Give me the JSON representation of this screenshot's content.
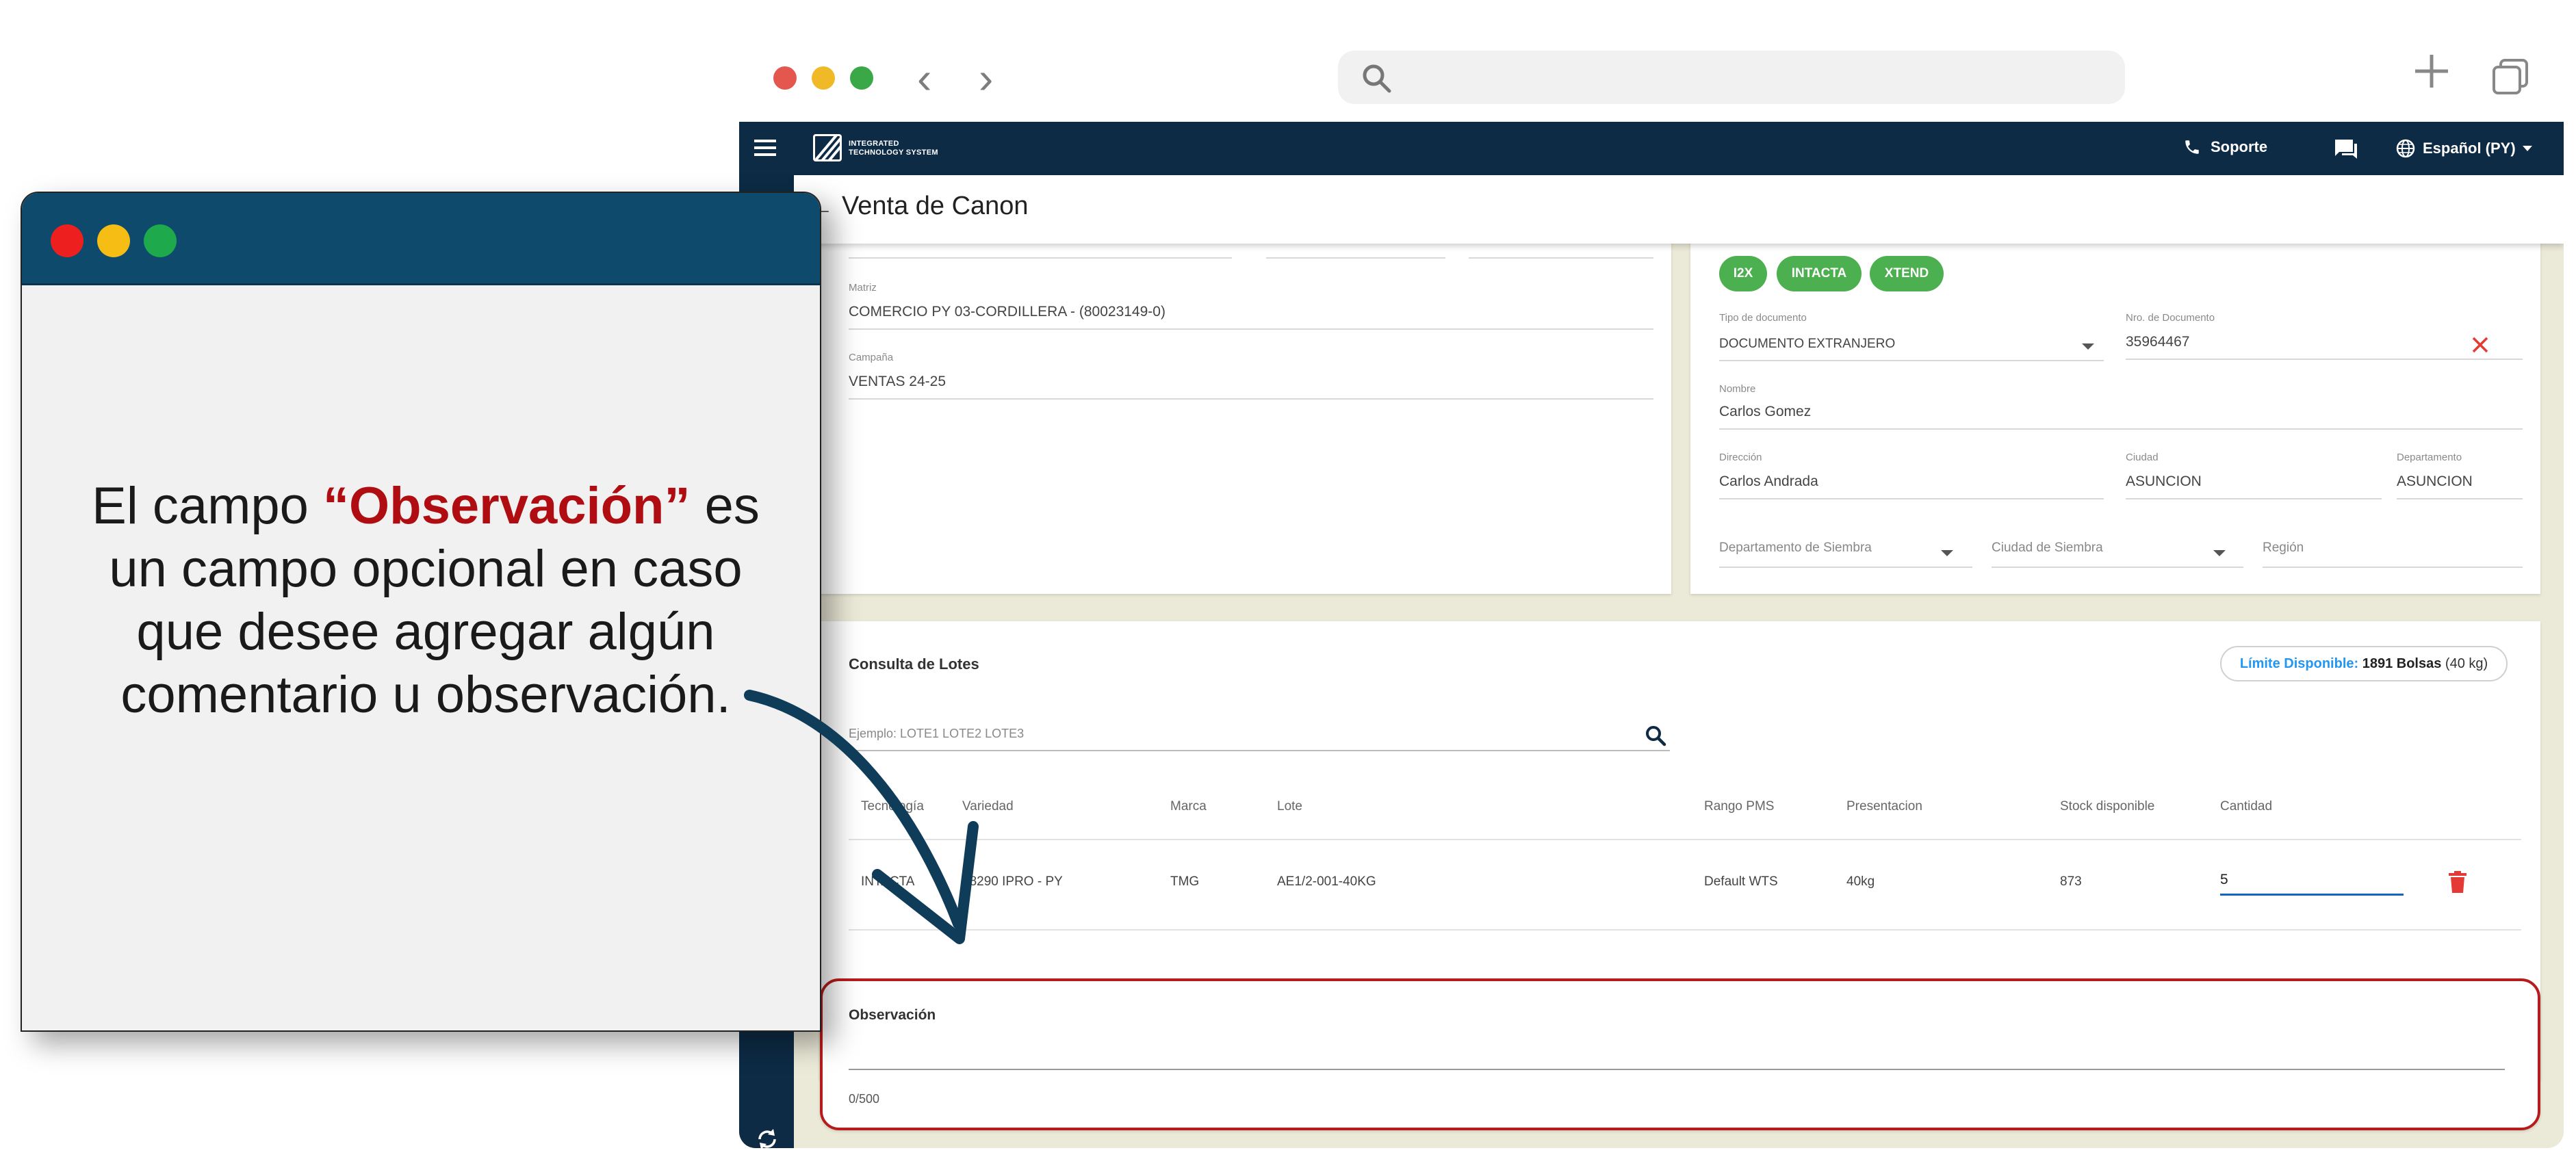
{
  "browser": {
    "dot_colors": [
      "#e4574f",
      "#f0b928",
      "#3aa847"
    ]
  },
  "topbar": {
    "logo_line1": "INTEGRATED",
    "logo_line2": "TECHNOLOGY SYSTEM",
    "support_label": "Soporte",
    "language_label": "Español (PY)"
  },
  "page": {
    "title": "Venta de Canon"
  },
  "left_card": {
    "matriz_label": "Matriz",
    "matriz_value": "COMERCIO PY 03-CORDILLERA - (80023149-0)",
    "campania_label": "Campaña",
    "campania_value": "VENTAS 24-25"
  },
  "client_card": {
    "chips": [
      "I2X",
      "INTACTA",
      "XTEND"
    ],
    "tipo_doc_label": "Tipo de documento",
    "tipo_doc_value": "DOCUMENTO EXTRANJERO",
    "nro_doc_label": "Nro. de Documento",
    "nro_doc_value": "35964467",
    "nombre_label": "Nombre",
    "nombre_value": "Carlos Gomez",
    "direccion_label": "Dirección",
    "direccion_value": "Carlos Andrada",
    "ciudad_label": "Ciudad",
    "ciudad_value": "ASUNCION",
    "departamento_label": "Departamento",
    "departamento_value": "ASUNCION",
    "depto_siembra_label": "Departamento de Siembra",
    "ciudad_siembra_label": "Ciudad de Siembra",
    "region_label": "Región"
  },
  "lotes": {
    "title": "Consulta de Lotes",
    "limit_key": "Límite Disponible:",
    "limit_value": "1891 Bolsas",
    "limit_unit": "(40 kg)",
    "search_placeholder": "Ejemplo: LOTE1 LOTE2 LOTE3",
    "columns": [
      "Tecnología",
      "Variedad",
      "Marca",
      "Lote",
      "Rango PMS",
      "Presentacion",
      "Stock disponible",
      "Cantidad"
    ],
    "row": [
      "INTACTA",
      "18290 IPRO - PY",
      "TMG",
      "AE1/2-001-40KG",
      "Default WTS",
      "40kg",
      "873",
      "5"
    ]
  },
  "observacion": {
    "label": "Observación",
    "counter": "0/500"
  },
  "callout": {
    "text_before": "El campo ",
    "highlight": "“Observación”",
    "text_after": " es un campo opcional en caso que desee agregar algún comentario u observación.",
    "dot_colors": [
      "#ee1f1f",
      "#f6bd14",
      "#1ea94d"
    ]
  }
}
